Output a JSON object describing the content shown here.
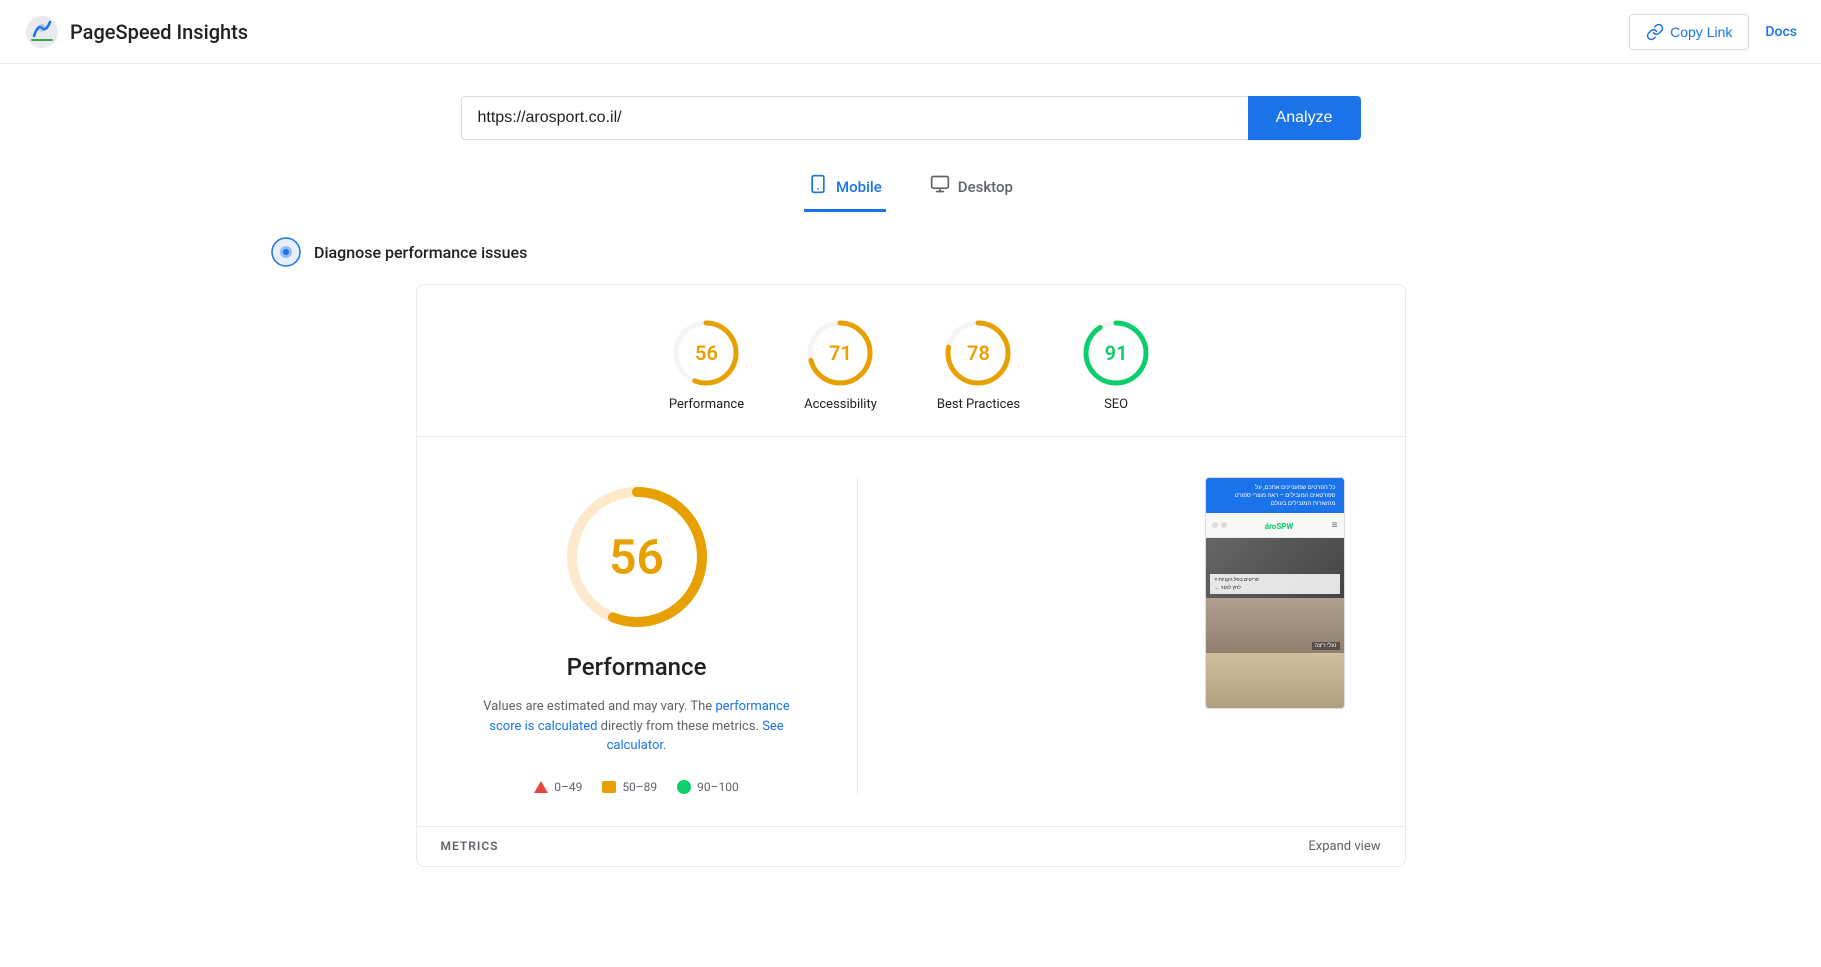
{
  "header": {
    "title": "PageSpeed Insights",
    "copy_link_label": "Copy Link",
    "docs_label": "Docs"
  },
  "search": {
    "url_value": "https://arosport.co.il/",
    "analyze_label": "Analyze"
  },
  "tabs": [
    {
      "id": "mobile",
      "label": "Mobile",
      "active": true
    },
    {
      "id": "desktop",
      "label": "Desktop",
      "active": false
    }
  ],
  "diagnose": {
    "title": "Diagnose performance issues"
  },
  "scores": [
    {
      "id": "performance",
      "value": 56,
      "label": "Performance",
      "color_class": "stroke-orange",
      "text_class": "color-orange",
      "percent": 56
    },
    {
      "id": "accessibility",
      "value": 71,
      "label": "Accessibility",
      "color_class": "stroke-orange",
      "text_class": "color-orange",
      "percent": 71
    },
    {
      "id": "best-practices",
      "value": 78,
      "label": "Best Practices",
      "color_class": "stroke-orange",
      "text_class": "color-orange",
      "percent": 78
    },
    {
      "id": "seo",
      "value": 91,
      "label": "SEO",
      "color_class": "stroke-green",
      "text_class": "color-green",
      "percent": 91
    }
  ],
  "detail": {
    "score": 56,
    "title": "Performance",
    "desc_static": "Values are estimated and may vary. The ",
    "desc_link1": "performance score is calculated",
    "desc_mid": " directly from these metrics. ",
    "desc_link2": "See calculator.",
    "legend": [
      {
        "id": "red",
        "range": "0–49"
      },
      {
        "id": "orange",
        "range": "50–89"
      },
      {
        "id": "green",
        "range": "90–100"
      }
    ]
  },
  "metrics_bar": {
    "label": "METRICS",
    "expand_label": "Expand view"
  },
  "screenshot": {
    "top_text": "פרטי מוצרים לספורטאים – ראה מוצרי ספורט\nמהשורות המובילים בעולם",
    "logo_text": "ároSPW",
    "img1_label1": "× פריטים בסל הקניות",
    "img1_label2": "→ לחץ למנוי",
    "img2_label": "נעלי ריצה"
  }
}
